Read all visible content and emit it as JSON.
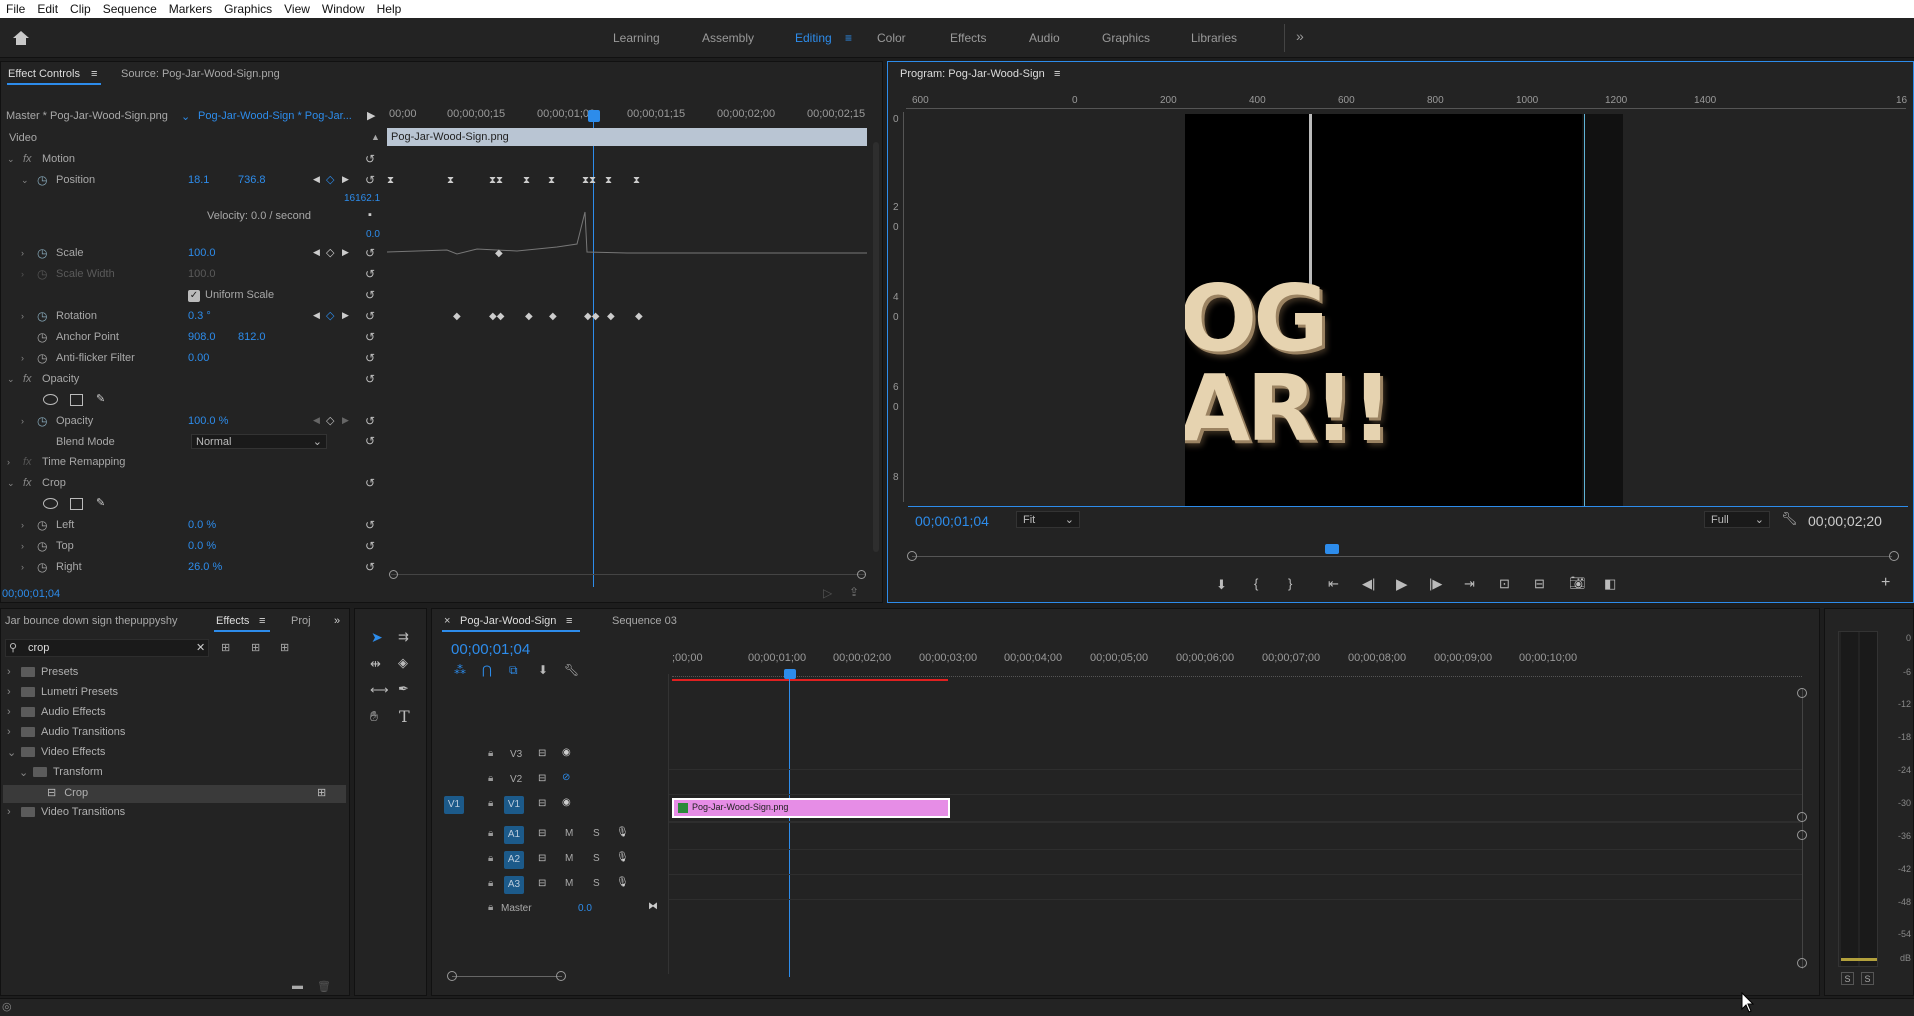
{
  "menu": [
    "File",
    "Edit",
    "Clip",
    "Sequence",
    "Markers",
    "Graphics",
    "View",
    "Window",
    "Help"
  ],
  "workspaces": [
    "Learning",
    "Assembly",
    "Editing",
    "Color",
    "Effects",
    "Audio",
    "Graphics",
    "Libraries"
  ],
  "active_workspace": "Editing",
  "effect_controls": {
    "tab_label": "Effect Controls",
    "source_tab": "Source: Pog-Jar-Wood-Sign.png",
    "master_label": "Master * Pog-Jar-Wood-Sign.png",
    "clip_label": "Pog-Jar-Wood-Sign * Pog-Jar...",
    "ruler": [
      "00;00",
      "00;00;00;15",
      "00;00;01;00",
      "00;00;01;15",
      "00;00;02;00",
      "00;00;02;15"
    ],
    "clip_bar": "Pog-Jar-Wood-Sign.png",
    "video": "Video",
    "motion": "Motion",
    "fx": "fx",
    "position": {
      "label": "Position",
      "x": "18.1",
      "y": "736.8"
    },
    "graph_max": "16162.1",
    "graph_min": "0.0",
    "velocity": "Velocity: 0.0 / second",
    "scale": {
      "label": "Scale",
      "value": "100.0"
    },
    "scale_width": {
      "label": "Scale Width",
      "value": "100.0"
    },
    "uniform_scale": "Uniform Scale",
    "rotation": {
      "label": "Rotation",
      "value": "0.3 °"
    },
    "anchor": {
      "label": "Anchor Point",
      "x": "908.0",
      "y": "812.0"
    },
    "antiflicker": {
      "label": "Anti-flicker Filter",
      "value": "0.00"
    },
    "opacity_group": "Opacity",
    "opacity": {
      "label": "Opacity",
      "value": "100.0 %"
    },
    "blend": {
      "label": "Blend Mode",
      "value": "Normal"
    },
    "time_remap": "Time Remapping",
    "crop_group": "Crop",
    "left": {
      "label": "Left",
      "value": "0.0 %"
    },
    "top": {
      "label": "Top",
      "value": "0.0 %"
    },
    "right": {
      "label": "Right",
      "value": "26.0 %"
    },
    "timecode": "00;00;01;04"
  },
  "program": {
    "title": "Program: Pog-Jar-Wood-Sign",
    "ruler": [
      "600",
      "0",
      "200",
      "400",
      "600",
      "800",
      "1000",
      "1200",
      "1400",
      "16"
    ],
    "vruler": [
      "0",
      "2",
      "0",
      "4",
      "0",
      "6",
      "0",
      "8"
    ],
    "sign_text": "OG\nAR!!",
    "timecode": "00;00;01;04",
    "fit": "Fit",
    "quality": "Full",
    "duration": "00;00;02;20"
  },
  "project": {
    "title": "Jar bounce down sign thepuppyshy",
    "tab_effects": "Effects",
    "tab_proj": "Proj",
    "search": "crop",
    "tree": [
      {
        "label": "Presets",
        "depth": 0
      },
      {
        "label": "Lumetri Presets",
        "depth": 0
      },
      {
        "label": "Audio Effects",
        "depth": 0
      },
      {
        "label": "Audio Transitions",
        "depth": 0
      },
      {
        "label": "Video Effects",
        "depth": 0
      },
      {
        "label": "Transform",
        "depth": 1
      },
      {
        "label": "Crop",
        "depth": 2
      },
      {
        "label": "Video Transitions",
        "depth": 0
      }
    ]
  },
  "timeline": {
    "tab": "Pog-Jar-Wood-Sign",
    "tab2": "Sequence 03",
    "timecode": "00;00;01;04",
    "ruler": [
      ";00;00",
      "00;00;01;00",
      "00;00;02;00",
      "00;00;03;00",
      "00;00;04;00",
      "00;00;05;00",
      "00;00;06;00",
      "00;00;07;00",
      "00;00;08;00",
      "00;00;09;00",
      "00;00;10;00"
    ],
    "tracks": [
      "V3",
      "V2",
      "V1",
      "A1",
      "A2",
      "A3"
    ],
    "master": "Master",
    "master_val": "0.0",
    "clip": "Pog-Jar-Wood-Sign.png",
    "M": "M",
    "S": "S",
    "v1_src": "V1"
  },
  "meter": {
    "ticks": [
      "0",
      "-6",
      "-12",
      "-18",
      "-24",
      "-30",
      "-36",
      "-42",
      "-48",
      "-54",
      "dB"
    ],
    "s1": "S",
    "s2": "S"
  },
  "colors": {
    "accent": "#2d8ceb",
    "clip": "#e68de6"
  }
}
